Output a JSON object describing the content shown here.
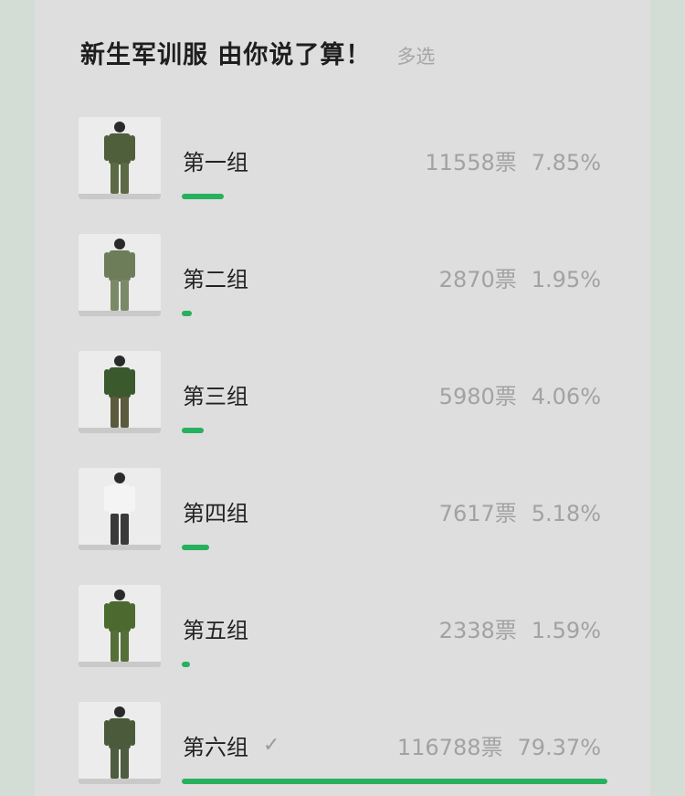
{
  "poll": {
    "title": "新生军训服 由你说了算！",
    "mode": "多选",
    "accent": "#27b05e"
  },
  "options": [
    {
      "label": "第一组",
      "votes": "11558票",
      "percent": "7.85%",
      "fraction": 0.0785,
      "selected": false,
      "shirt": "#4f5e3b",
      "pants": "#5b6a44"
    },
    {
      "label": "第二组",
      "votes": "2870票",
      "percent": "1.95%",
      "fraction": 0.0195,
      "selected": false,
      "shirt": "#6d7d5a",
      "pants": "#7b8a66"
    },
    {
      "label": "第三组",
      "votes": "5980票",
      "percent": "4.06%",
      "fraction": 0.0406,
      "selected": false,
      "shirt": "#3a5a2e",
      "pants": "#5c5a3d"
    },
    {
      "label": "第四组",
      "votes": "7617票",
      "percent": "5.18%",
      "fraction": 0.0518,
      "selected": false,
      "shirt": "#f4f4f4",
      "pants": "#3a3a3a"
    },
    {
      "label": "第五组",
      "votes": "2338票",
      "percent": "1.59%",
      "fraction": 0.0159,
      "selected": false,
      "shirt": "#4c6a30",
      "pants": "#556f38"
    },
    {
      "label": "第六组",
      "votes": "116788票",
      "percent": "79.37%",
      "fraction": 0.7937,
      "selected": true,
      "shirt": "#4a5a3a",
      "pants": "#4e5c3f"
    }
  ],
  "check_icon": "checkmark-icon"
}
